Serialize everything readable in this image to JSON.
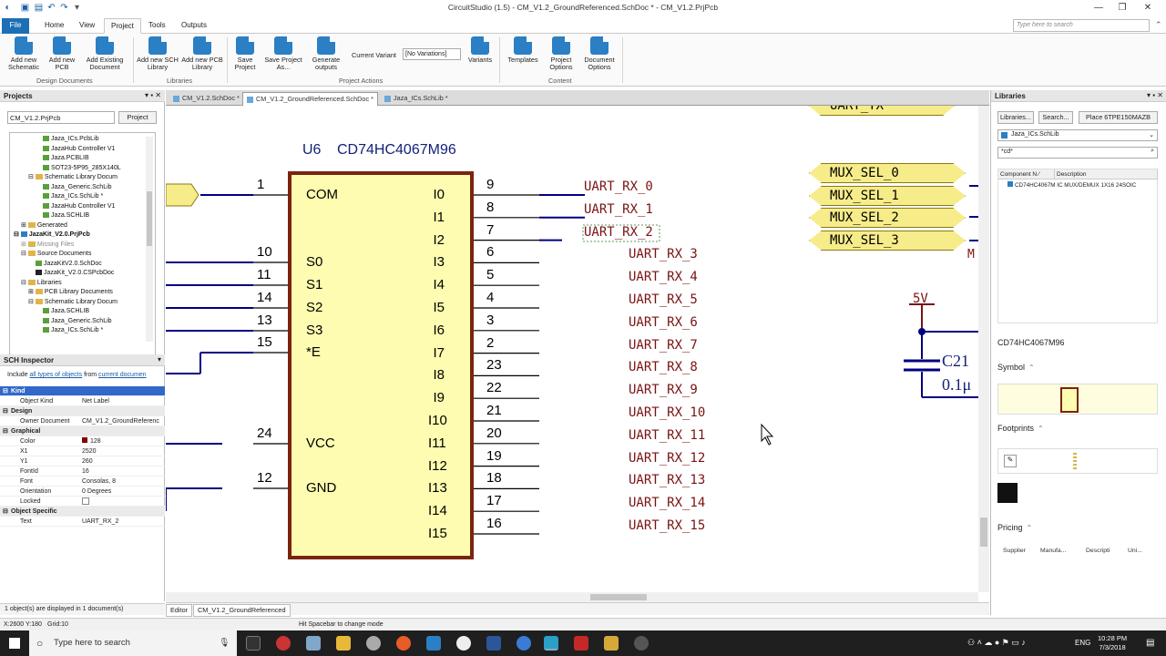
{
  "app": {
    "title": "CircuitStudio (1.5) - CM_V1.2_GroundReferenced.SchDoc * - CM_V1.2.PrjPcb"
  },
  "tabs": {
    "file": "File",
    "home": "Home",
    "view": "View",
    "project": "Project",
    "tools": "Tools",
    "outputs": "Outputs"
  },
  "ribbon": {
    "search_placeholder": "Type here to search",
    "buttons": [
      "Add new Schematic",
      "Add new PCB",
      "Add Existing Document",
      "Add new SCH Library",
      "Add new PCB Library",
      "Save Project",
      "Save Project As...",
      "Generate outputs",
      "Variants",
      "Templates",
      "Project Options",
      "Document Options"
    ],
    "groups": [
      "Design Documents",
      "Libraries",
      "Project Actions",
      "Content"
    ],
    "variant_label": "Current Variant",
    "variant_value": "[No Variations]"
  },
  "projects": {
    "title": "Projects",
    "input": "CM_V1.2.PrjPcb",
    "button": "Project",
    "tree": [
      "Jaza_ICs.PcbLib",
      "JazaHub Controller V1",
      "Jaza.PCBLIB",
      "SOT23-5P95_285X140L",
      "Schematic Library Docum",
      "Jaza_Generic.SchLib",
      "Jaza_ICs.SchLib *",
      "JazaHub Controller V1",
      "Jaza.SCHLIB",
      "Generated",
      "JazaKit_V2.0.PrjPcb",
      "Missing Files",
      "Source Documents",
      "JazaKitV2.0.SchDoc",
      "JazaKit_V2.0.CSPcbDoc",
      "Libraries",
      "PCB Library Documents",
      "Schematic Library Docum",
      "Jaza.SCHLIB",
      "Jaza_Generic.SchLib",
      "Jaza_ICs.SchLib *"
    ]
  },
  "inspector": {
    "title": "SCH Inspector",
    "include": "Include",
    "all_types": "all types of objects",
    "from": "from",
    "current_doc": "current documen",
    "rows": [
      {
        "k": "Kind",
        "v": "",
        "cat": true
      },
      {
        "k": "Object Kind",
        "v": "Net Label"
      },
      {
        "k": "Design",
        "v": "",
        "cat": true
      },
      {
        "k": "Owner Document",
        "v": "CM_V1.2_GroundReferenc"
      },
      {
        "k": "Graphical",
        "v": "",
        "cat": true
      },
      {
        "k": "Color",
        "v": "128"
      },
      {
        "k": "X1",
        "v": "2520"
      },
      {
        "k": "Y1",
        "v": "260"
      },
      {
        "k": "FontId",
        "v": "16"
      },
      {
        "k": "Font",
        "v": "Consolas, 8"
      },
      {
        "k": "Orientation",
        "v": "0 Degrees"
      },
      {
        "k": "Locked",
        "v": ""
      },
      {
        "k": "Object Specific",
        "v": "",
        "cat": true
      },
      {
        "k": "Text",
        "v": "UART_RX_2"
      }
    ],
    "status": "1 object(s) are displayed in 1 document(s)"
  },
  "doctabs": [
    "CM_V1.2.SchDoc *",
    "CM_V1.2_GroundReferenced.SchDoc *",
    "Jaza_ICs.SchLib *"
  ],
  "editor_tabs": [
    "Editor",
    "CM_V1.2_GroundReferenced"
  ],
  "schematic": {
    "designator": "U6",
    "part": "CD74HC4067M96",
    "left_pins": [
      {
        "n": "1",
        "name": "COM"
      },
      {
        "n": "10",
        "name": "S0"
      },
      {
        "n": "11",
        "name": "S1"
      },
      {
        "n": "14",
        "name": "S2"
      },
      {
        "n": "13",
        "name": "S3"
      },
      {
        "n": "15",
        "name": "*E"
      },
      {
        "n": "24",
        "name": "VCC"
      },
      {
        "n": "12",
        "name": "GND"
      }
    ],
    "right_pins": [
      {
        "n": "9",
        "name": "I0"
      },
      {
        "n": "8",
        "name": "I1"
      },
      {
        "n": "7",
        "name": "I2"
      },
      {
        "n": "6",
        "name": "I3"
      },
      {
        "n": "5",
        "name": "I4"
      },
      {
        "n": "4",
        "name": "I5"
      },
      {
        "n": "3",
        "name": "I6"
      },
      {
        "n": "2",
        "name": "I7"
      },
      {
        "n": "23",
        "name": "I8"
      },
      {
        "n": "22",
        "name": "I9"
      },
      {
        "n": "21",
        "name": "I10"
      },
      {
        "n": "20",
        "name": "I11"
      },
      {
        "n": "19",
        "name": "I12"
      },
      {
        "n": "18",
        "name": "I13"
      },
      {
        "n": "17",
        "name": "I14"
      },
      {
        "n": "16",
        "name": "I15"
      }
    ],
    "net_labels": [
      "UART_RX_0",
      "UART_RX_1",
      "UART_RX_2",
      "UART_RX_3",
      "UART_RX_4",
      "UART_RX_5",
      "UART_RX_6",
      "UART_RX_7",
      "UART_RX_8",
      "UART_RX_9",
      "UART_RX_10",
      "UART_RX_11",
      "UART_RX_12",
      "UART_RX_13",
      "UART_RX_14",
      "UART_RX_15"
    ],
    "ports": [
      "UART_TX",
      "MUX_SEL_0",
      "MUX_SEL_1",
      "MUX_SEL_2",
      "MUX_SEL_3"
    ],
    "power": "5V",
    "cap_name": "C21",
    "cap_value": "0.1μ",
    "partial": "M"
  },
  "libraries": {
    "title": "Libraries",
    "btn1": "Libraries...",
    "btn2": "Search...",
    "btn3": "Place 6TPE150MAZB",
    "lib": "Jaza_ICs.SchLib",
    "filter": "*cd*",
    "col1": "Component N",
    "col2": "Description",
    "row_name": "CD74HC4067M",
    "row_desc": "IC MUX/DEMUX 1X16 24SOIC",
    "comp": "CD74HC4067M96",
    "symbol": "Symbol",
    "footprints": "Footprints",
    "pricing": "Pricing",
    "pricing_cols": [
      "Supplier",
      "Manufa...",
      "Descripti",
      "Uni..."
    ]
  },
  "status": {
    "coords": "X:2600 Y:180",
    "grid": "Grid:10",
    "hint": "Hit Spacebar to change mode"
  },
  "taskbar": {
    "search": "Type here to search",
    "time": "10:28 PM",
    "date": "7/3/2018",
    "lang": "ENG"
  },
  "colors": {
    "accent": "#1c6fb5",
    "wire": "#000080",
    "part_fill": "#fdfcb0",
    "part_border": "#7a2410",
    "netlabel": "#7a1212"
  }
}
